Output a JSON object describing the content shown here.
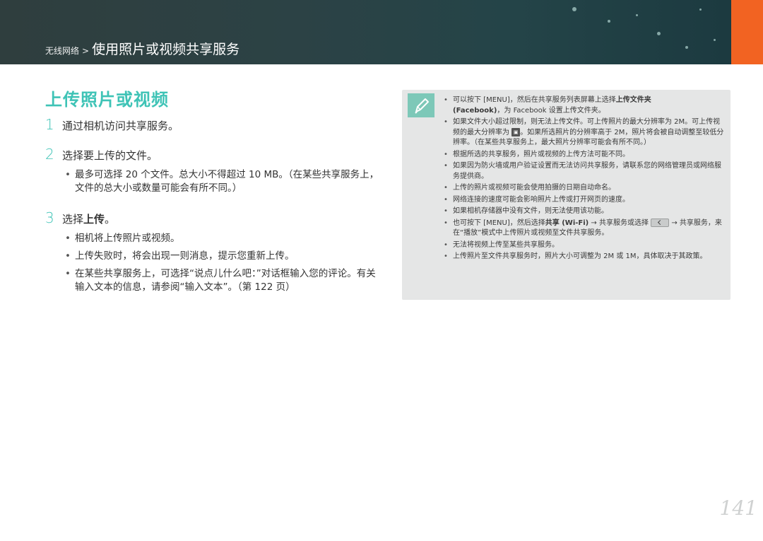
{
  "header": {
    "breadcrumb_parent": "无线网络",
    "breadcrumb_separator": ">",
    "breadcrumb_current": "使用照片或视频共享服务"
  },
  "section_title": "上传照片或视频",
  "steps": [
    {
      "num": "1",
      "text": "通过相机访问共享服务。"
    },
    {
      "num": "2",
      "text": "选择要上传的文件。"
    },
    {
      "num": "3",
      "text_prefix": "选择",
      "text_bold": "上传",
      "text_suffix": "。"
    }
  ],
  "step2_bullets": [
    "最多可选择 20 个文件。总大小不得超过 10 MB。（在某些共享服务上，文件的总大小或数量可能会有所不同。）"
  ],
  "step3_bullets": [
    "相机将上传照片或视频。",
    "上传失败时，将会出现一则消息，提示您重新上传。",
    "在某些共享服务上，可选择“说点儿什么吧：”对话框输入您的评论。有关输入文本的信息，请参阅“输入文本”。（第 122 页）"
  ],
  "note": {
    "icon": "pencil-note-icon",
    "items": {
      "n1_a": "可以按下 [MENU]，然后在共享服务列表屏幕上选择",
      "n1_b": "上传文件夹",
      "n1_c": "(Facebook)",
      "n1_d": "，为 Facebook 设置上传文件夹。",
      "n2_a": "如果文件大小超过限制，则无法上传文件。可上传照片的最大分辨率为 2M。可上传视频的最大分辨率为",
      "n2_icon": "video-size-icon",
      "n2_b": "。如果所选照片的分辨率高于 2M，照片将会被自动调整至较低分辨率。（在某些共享服务上，最大照片分辨率可能会有所不同。）",
      "n3": "根据所选的共享服务，照片或视频的上传方法可能不同。",
      "n4": "如果因为防火墙或用户验证设置而无法访问共享服务，请联系您的网络管理员或网络服务提供商。",
      "n5": "上传的照片或视频可能会使用拍摄的日期自动命名。",
      "n6": "网络连接的速度可能会影响照片上传或打开网页的速度。",
      "n7": "如果相机存储器中没有文件，则无法使用该功能。",
      "n8_a": "也可按下 [MENU]，然后选择",
      "n8_b": "共享 (Wi-Fi)",
      "n8_c": "→ 共享服务或选择",
      "n8_icon": "share-key-icon",
      "n8_d": "→ 共享服务，来在“播放”模式中上传照片或视频至文件共享服务。",
      "n9": "无法将视频上传至某些共享服务。",
      "n10": "上传照片至文件共享服务时，照片大小可调整为 2M 或 1M，具体取决于其政策。"
    }
  },
  "page_number": "141",
  "colors": {
    "accent": "#3ec3b6",
    "orange": "#f26322",
    "header_bg": "#2c4245",
    "note_bg": "#e5e6e6"
  }
}
